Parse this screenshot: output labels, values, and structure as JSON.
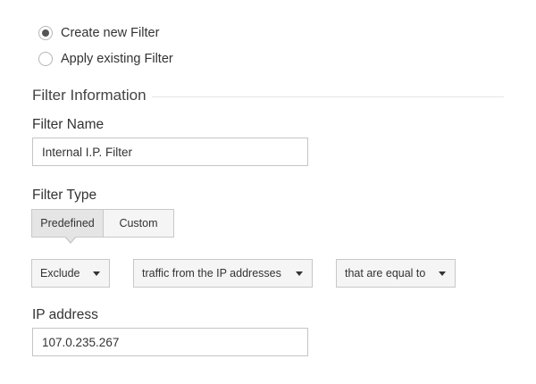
{
  "filter_mode": {
    "options": [
      {
        "label": "Create new Filter",
        "selected": true
      },
      {
        "label": "Apply existing Filter",
        "selected": false
      }
    ]
  },
  "section": {
    "title": "Filter Information"
  },
  "filter_name": {
    "label": "Filter Name",
    "value": "Internal I.P. Filter"
  },
  "filter_type": {
    "label": "Filter Type",
    "tabs": [
      {
        "label": "Predefined",
        "active": true
      },
      {
        "label": "Custom",
        "active": false
      }
    ],
    "action_dropdown": {
      "value": "Exclude",
      "icon": "chevron-down-icon"
    },
    "source_dropdown": {
      "value": "traffic from the IP addresses",
      "icon": "chevron-down-icon"
    },
    "condition_dropdown": {
      "value": "that are equal to",
      "icon": "chevron-down-icon"
    }
  },
  "ip_address": {
    "label": "IP address",
    "value": "107.0.235.267"
  }
}
